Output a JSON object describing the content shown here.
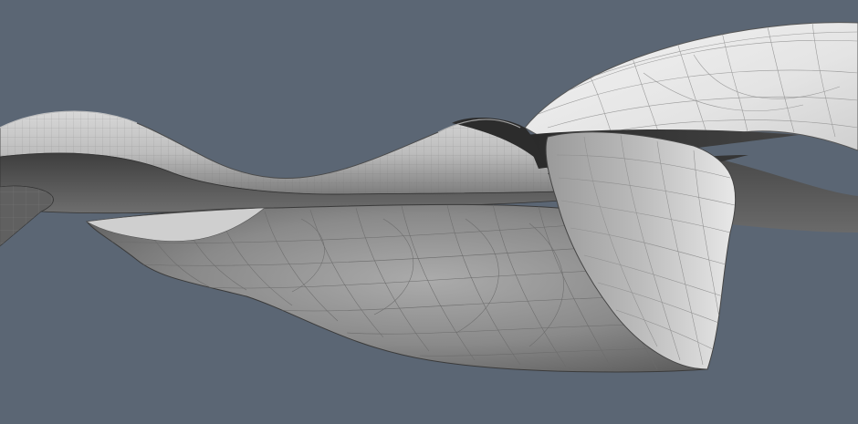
{
  "viewport": {
    "background_color": "#5b6674",
    "content": "3d-mesh-render"
  },
  "palette": {
    "surface_light": "#e9e9e9",
    "surface_mid": "#a8a8a8",
    "surface_dark": "#3a3a3a",
    "shadow": "#1f1f1f",
    "wire": "#8a8a8a"
  }
}
